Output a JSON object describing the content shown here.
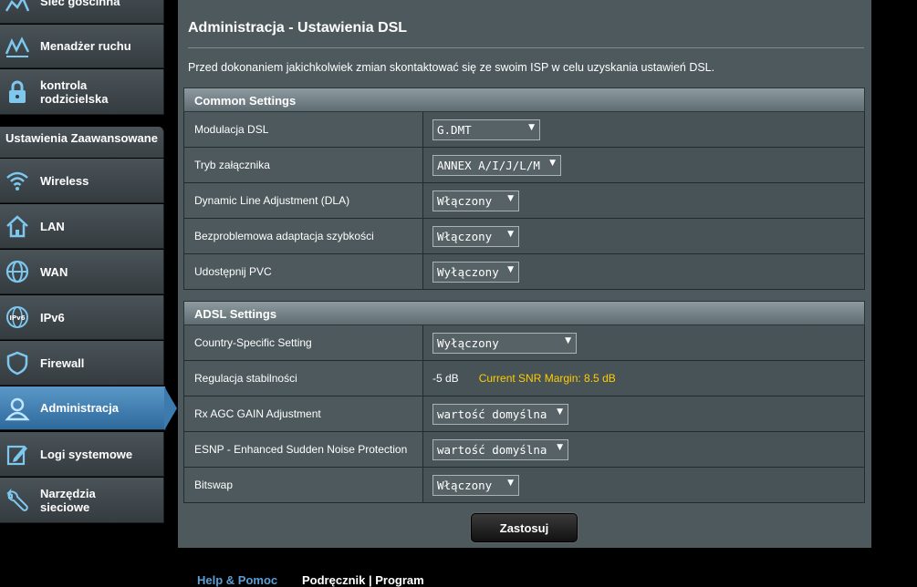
{
  "sidebar": {
    "top_items": [
      {
        "label": "Sieć gościnna",
        "icon": "globe-network-icon"
      },
      {
        "label": "Menadżer ruchu",
        "icon": "traffic-chart-icon"
      },
      {
        "label": "kontrola rodzicielska",
        "icon": "lock-icon"
      }
    ],
    "advanced_header": "Ustawienia Zaawansowane",
    "items": [
      {
        "label": "Wireless",
        "icon": "wifi-icon"
      },
      {
        "label": "LAN",
        "icon": "home-icon"
      },
      {
        "label": "WAN",
        "icon": "globe-icon"
      },
      {
        "label": "IPv6",
        "icon": "ipv6-globe-icon"
      },
      {
        "label": "Firewall",
        "icon": "shield-icon"
      },
      {
        "label": "Administracja",
        "icon": "user-icon",
        "active": true
      },
      {
        "label": "Logi systemowe",
        "icon": "edit-log-icon"
      },
      {
        "label": "Narzędzia sieciowe",
        "icon": "wrench-icon"
      }
    ]
  },
  "main": {
    "title": "Administracja - Ustawienia DSL",
    "description": "Przed dokonaniem jakichkolwiek zmian skontaktować się ze swoim ISP w celu uzyskania ustawień DSL.",
    "common": {
      "header": "Common Settings",
      "rows": [
        {
          "label": "Modulacja DSL",
          "value": "G.DMT"
        },
        {
          "label": "Tryb załącznika",
          "value": "ANNEX A/I/J/L/M"
        },
        {
          "label": "Dynamic Line Adjustment (DLA)",
          "value": "Włączony"
        },
        {
          "label": "Bezproblemowa adaptacja szybkości",
          "value": "Włączony"
        },
        {
          "label": "Udostępnij PVC",
          "value": "Wyłączony"
        }
      ]
    },
    "adsl": {
      "header": "ADSL Settings",
      "country": {
        "label": "Country-Specific Setting",
        "value": "Wyłączony"
      },
      "stability": {
        "label": "Regulacja stabilności",
        "value": "-5 dB",
        "snr": "Current SNR Margin: 8.5 dB"
      },
      "rx_agc": {
        "label": "Rx AGC GAIN Adjustment",
        "value": "wartość domyślna"
      },
      "esnp": {
        "label": "ESNP - Enhanced Sudden Noise Protection",
        "value": "wartość domyślna"
      },
      "bitswap": {
        "label": "Bitswap",
        "value": "Włączony"
      }
    },
    "apply_label": "Zastosuj"
  },
  "footer": {
    "help": "Help & Pomoc",
    "manual": "Podręcznik | Program"
  },
  "colors": {
    "accent": "#3d7bae",
    "snr": "#ffcc00",
    "panel": "#4d595d"
  }
}
